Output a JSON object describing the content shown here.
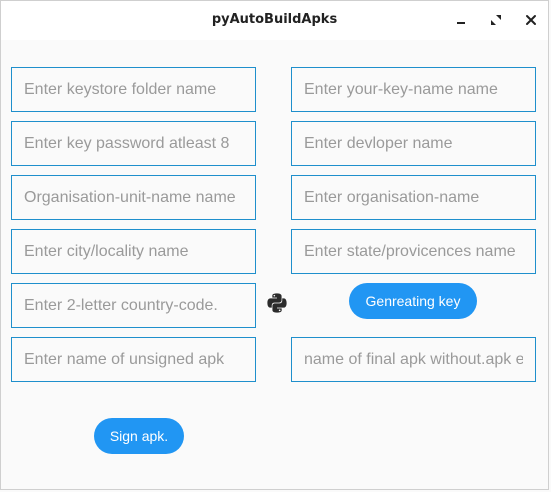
{
  "window": {
    "title": "pyAutoBuildApks"
  },
  "fields": {
    "keystore_folder": {
      "placeholder": "Enter keystore folder name",
      "value": ""
    },
    "key_name": {
      "placeholder": "Enter your-key-name name",
      "value": ""
    },
    "key_password": {
      "placeholder": "Enter key password atleast 8",
      "value": ""
    },
    "developer_name": {
      "placeholder": "Enter devloper name",
      "value": ""
    },
    "org_unit": {
      "placeholder": "Organisation-unit-name name",
      "value": ""
    },
    "org_name": {
      "placeholder": "Enter organisation-name",
      "value": ""
    },
    "city": {
      "placeholder": "Enter city/locality name",
      "value": ""
    },
    "state": {
      "placeholder": "Enter state/provicences name",
      "value": ""
    },
    "country_code": {
      "placeholder": "Enter 2-letter country-code.",
      "value": ""
    },
    "unsigned_apk": {
      "placeholder": "Enter name of unsigned apk",
      "value": ""
    },
    "final_apk": {
      "placeholder": "name of final apk without.apk ex.",
      "value": ""
    }
  },
  "buttons": {
    "generate_key": "Genreating key",
    "sign_apk": "Sign apk."
  },
  "icons": {
    "minimize": "minimize-icon",
    "maximize": "maximize-icon",
    "close": "close-icon",
    "logo": "python-logo-icon"
  },
  "colors": {
    "accent": "#2196f3",
    "field_border": "#1f8fcc",
    "python_logo": "#2b2b2b"
  }
}
